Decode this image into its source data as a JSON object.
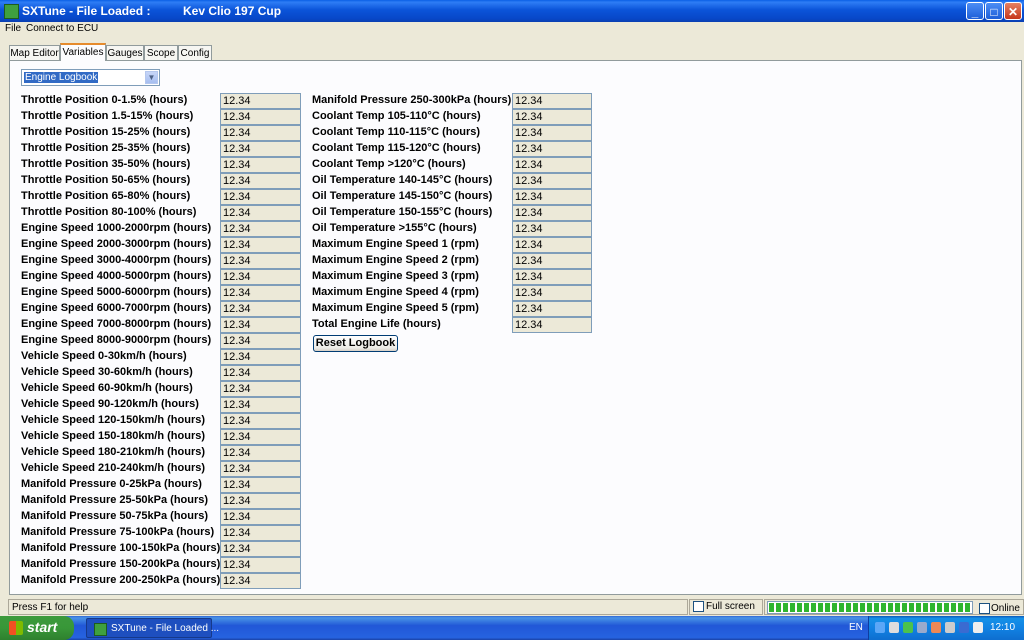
{
  "window": {
    "app_title": "SXTune - File Loaded :",
    "file_name": "Kev Clio 197 Cup",
    "minimize": "_",
    "maximize": "□",
    "close": "✕"
  },
  "menu": [
    "File",
    "Connect to ECU"
  ],
  "tabs": [
    "Map Editor",
    "Variables",
    "Gauges",
    "Scope",
    "Config"
  ],
  "active_tab": "Variables",
  "dropdown": {
    "value": "Engine Logbook",
    "arrow": "▼"
  },
  "variables_left": [
    {
      "label": "Throttle Position 0-1.5% (hours)",
      "value": "12.34"
    },
    {
      "label": "Throttle Position 1.5-15% (hours)",
      "value": "12.34"
    },
    {
      "label": "Throttle Position 15-25% (hours)",
      "value": "12.34"
    },
    {
      "label": "Throttle Position 25-35% (hours)",
      "value": "12.34"
    },
    {
      "label": "Throttle Position 35-50% (hours)",
      "value": "12.34"
    },
    {
      "label": "Throttle Position 50-65% (hours)",
      "value": "12.34"
    },
    {
      "label": "Throttle Position 65-80% (hours)",
      "value": "12.34"
    },
    {
      "label": "Throttle Position 80-100% (hours)",
      "value": "12.34"
    },
    {
      "label": "Engine Speed 1000-2000rpm (hours)",
      "value": "12.34"
    },
    {
      "label": "Engine Speed 2000-3000rpm (hours)",
      "value": "12.34"
    },
    {
      "label": "Engine Speed 3000-4000rpm (hours)",
      "value": "12.34"
    },
    {
      "label": "Engine Speed 4000-5000rpm (hours)",
      "value": "12.34"
    },
    {
      "label": "Engine Speed 5000-6000rpm (hours)",
      "value": "12.34"
    },
    {
      "label": "Engine Speed 6000-7000rpm (hours)",
      "value": "12.34"
    },
    {
      "label": "Engine Speed 7000-8000rpm (hours)",
      "value": "12.34"
    },
    {
      "label": "Engine Speed 8000-9000rpm (hours)",
      "value": "12.34"
    },
    {
      "label": "Vehicle Speed 0-30km/h (hours)",
      "value": "12.34"
    },
    {
      "label": "Vehicle Speed 30-60km/h (hours)",
      "value": "12.34"
    },
    {
      "label": "Vehicle Speed 60-90km/h (hours)",
      "value": "12.34"
    },
    {
      "label": "Vehicle Speed 90-120km/h (hours)",
      "value": "12.34"
    },
    {
      "label": "Vehicle Speed 120-150km/h (hours)",
      "value": "12.34"
    },
    {
      "label": "Vehicle Speed 150-180km/h (hours)",
      "value": "12.34"
    },
    {
      "label": "Vehicle Speed 180-210km/h (hours)",
      "value": "12.34"
    },
    {
      "label": "Vehicle Speed 210-240km/h (hours)",
      "value": "12.34"
    },
    {
      "label": "Manifold Pressure 0-25kPa (hours)",
      "value": "12.34"
    },
    {
      "label": "Manifold Pressure 25-50kPa (hours)",
      "value": "12.34"
    },
    {
      "label": "Manifold Pressure 50-75kPa (hours)",
      "value": "12.34"
    },
    {
      "label": "Manifold Pressure 75-100kPa (hours)",
      "value": "12.34"
    },
    {
      "label": "Manifold Pressure 100-150kPa (hours)",
      "value": "12.34"
    },
    {
      "label": "Manifold Pressure 150-200kPa (hours)",
      "value": "12.34"
    },
    {
      "label": "Manifold Pressure 200-250kPa (hours)",
      "value": "12.34"
    }
  ],
  "variables_right": [
    {
      "label": "Manifold Pressure 250-300kPa (hours)",
      "value": "12.34"
    },
    {
      "label": "Coolant Temp 105-110°C (hours)",
      "value": "12.34"
    },
    {
      "label": "Coolant Temp 110-115°C (hours)",
      "value": "12.34"
    },
    {
      "label": "Coolant Temp 115-120°C (hours)",
      "value": "12.34"
    },
    {
      "label": "Coolant Temp >120°C (hours)",
      "value": "12.34"
    },
    {
      "label": "Oil Temperature 140-145°C (hours)",
      "value": "12.34"
    },
    {
      "label": "Oil Temperature 145-150°C (hours)",
      "value": "12.34"
    },
    {
      "label": "Oil Temperature 150-155°C (hours)",
      "value": "12.34"
    },
    {
      "label": "Oil Temperature >155°C (hours)",
      "value": "12.34"
    },
    {
      "label": "Maximum Engine Speed 1 (rpm)",
      "value": "12.34"
    },
    {
      "label": "Maximum Engine Speed 2 (rpm)",
      "value": "12.34"
    },
    {
      "label": "Maximum Engine Speed 3 (rpm)",
      "value": "12.34"
    },
    {
      "label": "Maximum Engine Speed 4 (rpm)",
      "value": "12.34"
    },
    {
      "label": "Maximum Engine Speed 5 (rpm)",
      "value": "12.34"
    },
    {
      "label": "Total Engine Life (hours)",
      "value": "12.34"
    }
  ],
  "reset_button": "Reset Logbook",
  "status": {
    "help_text": "Press F1 for help",
    "fullscreen_label": "Full screen",
    "online_label": "Online",
    "progress": 1.0
  },
  "taskbar": {
    "start_label": "start",
    "task_label": "SXTune - File Loaded ...",
    "language": "EN",
    "clock": "12:10"
  },
  "colors": {
    "titlebar": "#0A5FE6",
    "tab_highlight": "#E68B2C",
    "progress_fill": "#2FB52F",
    "start_button": "#3C9A3C"
  }
}
